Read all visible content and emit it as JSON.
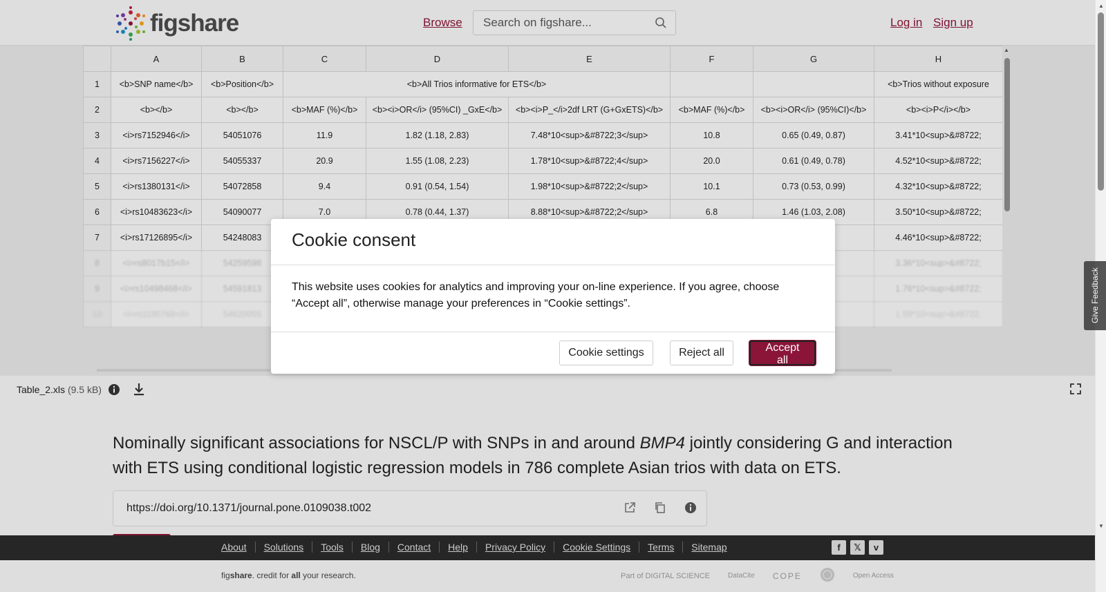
{
  "header": {
    "logo_text": "figshare",
    "browse": "Browse",
    "search_placeholder": "Search on figshare...",
    "login": "Log in",
    "signup": "Sign up"
  },
  "sheet": {
    "columns": [
      "A",
      "B",
      "C",
      "D",
      "E",
      "F",
      "G",
      "H"
    ],
    "rows": [
      {
        "n": "1",
        "cells": [
          "<b>SNP name</b>",
          "<b>Position</b>",
          "<b>All Trios informative for ETS</b>",
          "",
          "",
          "<b>Trios without exposure"
        ]
      },
      {
        "n": "2",
        "cells": [
          "<b></b>",
          "<b></b>",
          "<b>MAF (%)</b>",
          "<b><i>OR</i> (95%CI) _GxE</b>",
          "<b><i>P_</i>2df LRT (G+GxETS)</b>",
          "<b>MAF (%)</b>",
          "<b><i>OR</i> (95%CI)</b>",
          "<b><i>P</i></b>"
        ]
      },
      {
        "n": "3",
        "cells": [
          "<i>rs7152946</i>",
          "54051076",
          "11.9",
          "1.82 (1.18, 2.83)",
          "7.48*10<sup>&#8722;3</sup>",
          "10.8",
          "0.65 (0.49, 0.87)",
          "3.41*10<sup>&#8722;"
        ]
      },
      {
        "n": "4",
        "cells": [
          "<i>rs7156227</i>",
          "54055337",
          "20.9",
          "1.55 (1.08, 2.23)",
          "1.78*10<sup>&#8722;4</sup>",
          "20.0",
          "0.61 (0.49, 0.78)",
          "4.52*10<sup>&#8722;"
        ]
      },
      {
        "n": "5",
        "cells": [
          "<i>rs1380131</i>",
          "54072858",
          "9.4",
          "0.91 (0.54, 1.54)",
          "1.98*10<sup>&#8722;2</sup>",
          "10.1",
          "0.73 (0.53, 0.99)",
          "4.32*10<sup>&#8722;"
        ]
      },
      {
        "n": "6",
        "cells": [
          "<i>rs10483623</i>",
          "54090077",
          "7.0",
          "0.78 (0.44, 1.37)",
          "8.88*10<sup>&#8722;2</sup>",
          "6.8",
          "1.46 (1.03, 2.08)",
          "3.50*10<sup>&#8722;"
        ]
      },
      {
        "n": "7",
        "cells": [
          "<i>rs17126895</i>",
          "54248083",
          "",
          "",
          "",
          "",
          ".45)",
          "4.46*10<sup>&#8722;"
        ]
      },
      {
        "n": "8",
        "cells": [
          "<i>rs8017b15</i>",
          "54259598",
          "",
          "",
          "",
          "",
          ".88)",
          "3.36*10<sup>&#8722;"
        ]
      },
      {
        "n": "9",
        "cells": [
          "<i>rs10498468</i>",
          "54591813",
          "",
          "",
          "",
          "",
          ".40)",
          "1.76*10<sup>&#8722;"
        ]
      },
      {
        "n": "10",
        "cells": [
          "<i>rs1195768</i>",
          "54620055",
          "",
          "",
          "",
          "",
          ".00)",
          "1.59*10<sup>&#8722;"
        ]
      }
    ]
  },
  "file": {
    "name": "Table_2.xls",
    "size": "(9.5 kB)"
  },
  "item": {
    "title_pre": "Nominally significant associations for NSCL/P with SNPs in and around ",
    "title_gene": "BMP4",
    "title_post": " jointly considering G and interaction with ETS using conditional logistic regression models in 786 complete Asian trios with data on ETS.",
    "doi": "https://doi.org/10.1371/journal.pone.0109038.t002"
  },
  "footer": {
    "links": [
      "About",
      "Solutions",
      "Tools",
      "Blog",
      "Contact",
      "Help",
      "Privacy Policy",
      "Cookie Settings",
      "Terms",
      "Sitemap"
    ],
    "tagline_fig": "fig",
    "tagline_share": "share",
    "tagline_mid": ". credit for ",
    "tagline_all": "all",
    "tagline_end": " your research.",
    "partner_digital": "Part of DIGITAL SCIENCE",
    "partner_datacite": "DataCite",
    "partner_cope": "COPE",
    "partner_open": "Open Access"
  },
  "feedback": "Give Feedback",
  "cookie": {
    "title": "Cookie consent",
    "body": "This website uses cookies for analytics and improving your on-line experience. If you agree, choose “Accept all”, otherwise manage your preferences in “Cookie settings”.",
    "settings": "Cookie settings",
    "reject": "Reject all",
    "accept": "Accept all"
  },
  "colors": {
    "brand": "#8a1538",
    "footer_bg": "#2a2a2a"
  }
}
